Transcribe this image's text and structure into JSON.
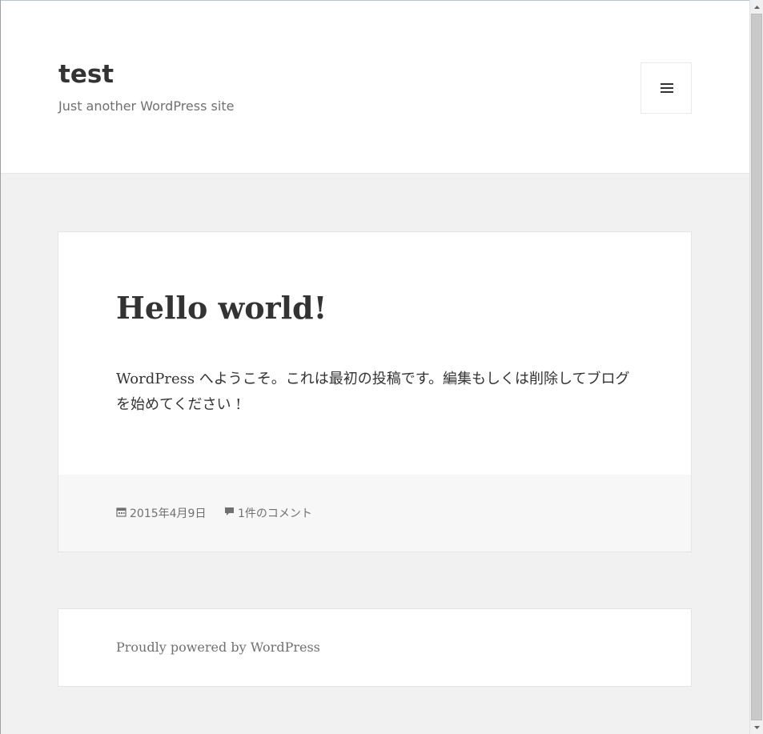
{
  "site": {
    "title": "test",
    "description": "Just another WordPress site"
  },
  "menu_toggle": {
    "icon": "hamburger-menu-icon"
  },
  "post": {
    "title": "Hello world!",
    "content": "WordPress へようこそ。これは最初の投稿です。編集もしくは削除してブログを始めてください !",
    "date": "2015年4月9日",
    "date_icon": "calendar-icon",
    "comments": "1件のコメント",
    "comments_icon": "comment-bubble-icon"
  },
  "footer": {
    "credit": "Proudly powered by WordPress"
  },
  "colors": {
    "background": "#f1f1f1",
    "card": "#ffffff",
    "text": "#333333",
    "muted": "#707070",
    "footer_band": "#f7f7f7"
  }
}
